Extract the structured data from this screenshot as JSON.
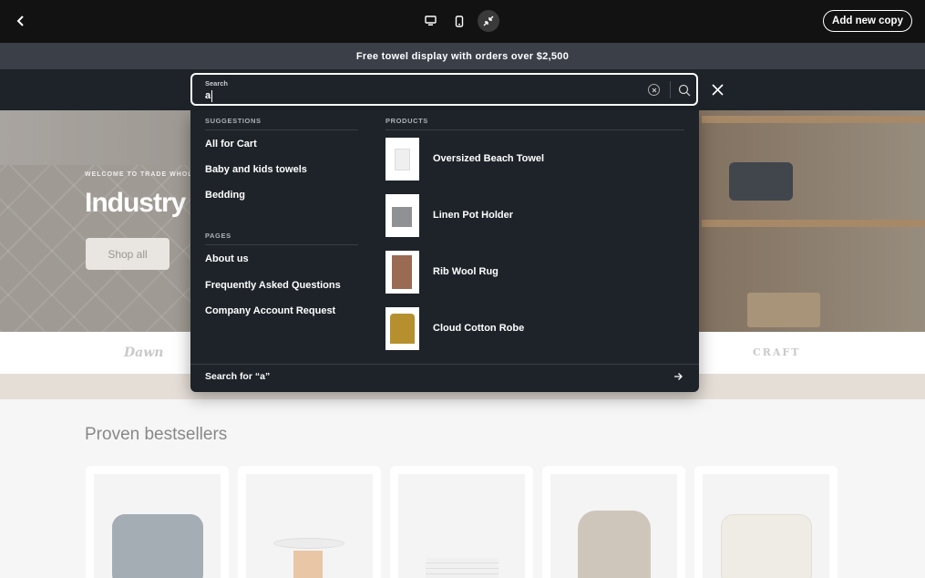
{
  "editor": {
    "add_copy_label": "Add new copy"
  },
  "icons": {
    "back": "chevron-left-icon",
    "desktop": "desktop-icon",
    "mobile": "mobile-icon",
    "fullscreen": "collapse-arrows-icon",
    "clear": "clear-x-icon",
    "search": "search-icon",
    "close": "close-icon",
    "arrow": "arrow-right-icon"
  },
  "announcement": "Free towel display with orders over $2,500",
  "search": {
    "label": "Search",
    "value": "a"
  },
  "hero": {
    "eyebrow": "WELCOME TO TRADE WHOL",
    "title": "Industry",
    "cta": "Shop all"
  },
  "brands": {
    "left": "Dawn",
    "right": "CRAFT"
  },
  "bestsellers": {
    "title": "Proven bestsellers"
  },
  "dropdown": {
    "suggestions_head": "SUGGESTIONS",
    "suggestions": [
      "All for Cart",
      "Baby and kids towels",
      "Bedding"
    ],
    "pages_head": "PAGES",
    "pages": [
      "About us",
      "Frequently Asked Questions",
      "Company Account Request"
    ],
    "products_head": "PRODUCTS",
    "products": [
      "Oversized Beach Towel",
      "Linen Pot Holder",
      "Rib Wool Rug",
      "Cloud Cotton Robe"
    ],
    "search_for": "Search for “a”"
  },
  "colors": {
    "editor_bar": "#121212",
    "announcement_bg": "#3a3f48",
    "panel_bg": "#1e2329",
    "accent_text": "#ffffff"
  }
}
